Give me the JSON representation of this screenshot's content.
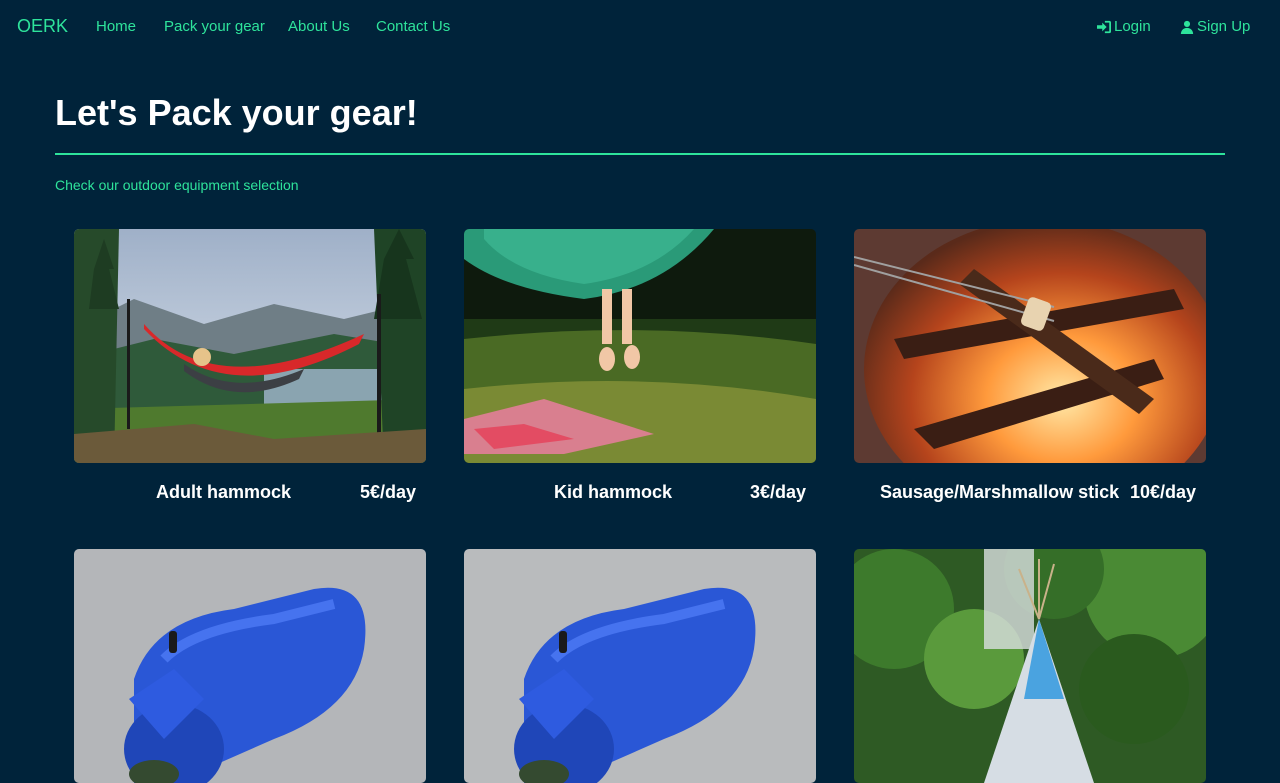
{
  "nav": {
    "brand": "OERK",
    "links": [
      "Home",
      "Pack your gear",
      "About Us",
      "Contact Us"
    ],
    "login": "Login",
    "signup": "Sign Up"
  },
  "page": {
    "title": "Let's Pack your gear!",
    "subtitle": "Check our outdoor equipment selection"
  },
  "products": [
    {
      "name": "Adult hammock",
      "price": "5€/day"
    },
    {
      "name": "Kid hammock",
      "price": "3€/day"
    },
    {
      "name": "Sausage/Marshmallow stick",
      "price": "10€/day"
    },
    {
      "name": "",
      "price": ""
    },
    {
      "name": "",
      "price": ""
    },
    {
      "name": "",
      "price": ""
    }
  ],
  "colors": {
    "background": "#00233a",
    "accent": "#2ee39b"
  }
}
